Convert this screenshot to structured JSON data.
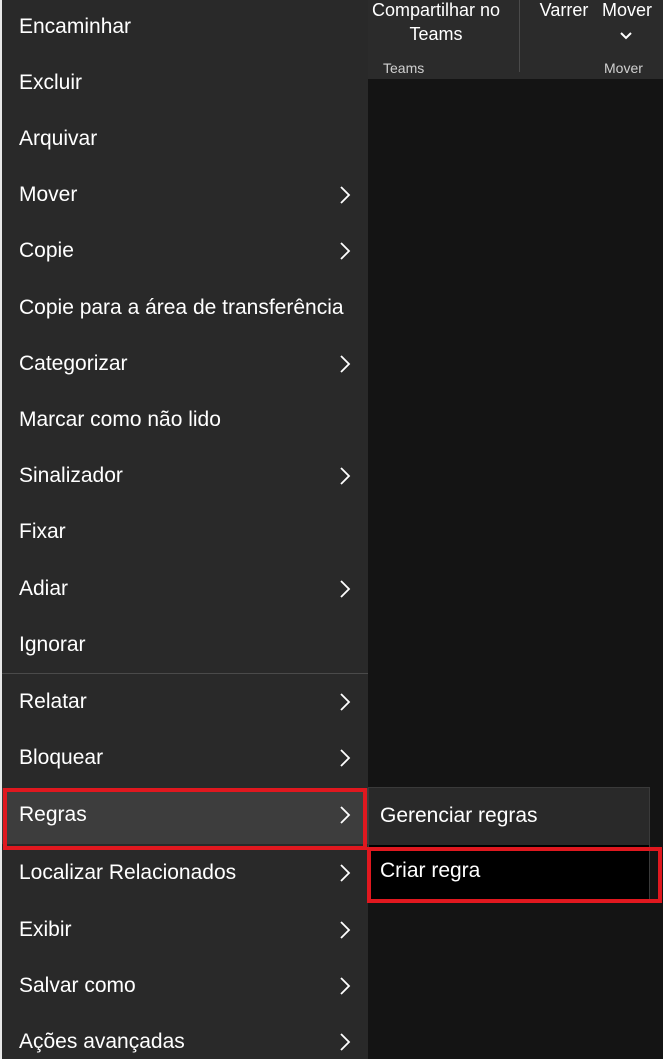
{
  "ribbon": {
    "share_teams_label": "Compartilhar no\nTeams",
    "sweep_label": "Varrer",
    "move_label": "Mover",
    "group_teams": "Teams",
    "group_move": "Mover"
  },
  "menu": {
    "items": [
      {
        "label": "Encaminhar",
        "submenu": false
      },
      {
        "label": "Excluir",
        "submenu": false
      },
      {
        "label": "Arquivar",
        "submenu": false
      },
      {
        "label": "Mover",
        "submenu": true
      },
      {
        "label": "Copie",
        "submenu": true
      },
      {
        "label": "Copie para a área de transferência",
        "submenu": false
      },
      {
        "label": "Categorizar",
        "submenu": true
      },
      {
        "label": "Marcar como não lido",
        "submenu": false
      },
      {
        "label": "Sinalizador",
        "submenu": true
      },
      {
        "label": "Fixar",
        "submenu": false
      },
      {
        "label": "Adiar",
        "submenu": true
      },
      {
        "label": "Ignorar",
        "submenu": false
      },
      {
        "label": "Relatar",
        "submenu": true
      },
      {
        "label": "Bloquear",
        "submenu": true
      },
      {
        "label": "Regras",
        "submenu": true
      },
      {
        "label": "Localizar Relacionados",
        "submenu": true
      },
      {
        "label": "Exibir",
        "submenu": true
      },
      {
        "label": "Salvar como",
        "submenu": true
      },
      {
        "label": "Ações avançadas",
        "submenu": true
      }
    ],
    "highlighted": "Regras"
  },
  "submenu": {
    "items": [
      {
        "label": "Gerenciar regras"
      },
      {
        "label": "Criar regra"
      }
    ],
    "selected": "Criar regra"
  },
  "colors": {
    "menu_bg": "#292929",
    "highlight_bg": "#3d3d3d",
    "selected_bg": "#000000",
    "outline_red": "#e0181f",
    "text": "#ffffff"
  },
  "icons": {
    "submenu_arrow": "chevron-right-icon",
    "dropdown_arrow": "chevron-down-icon"
  }
}
